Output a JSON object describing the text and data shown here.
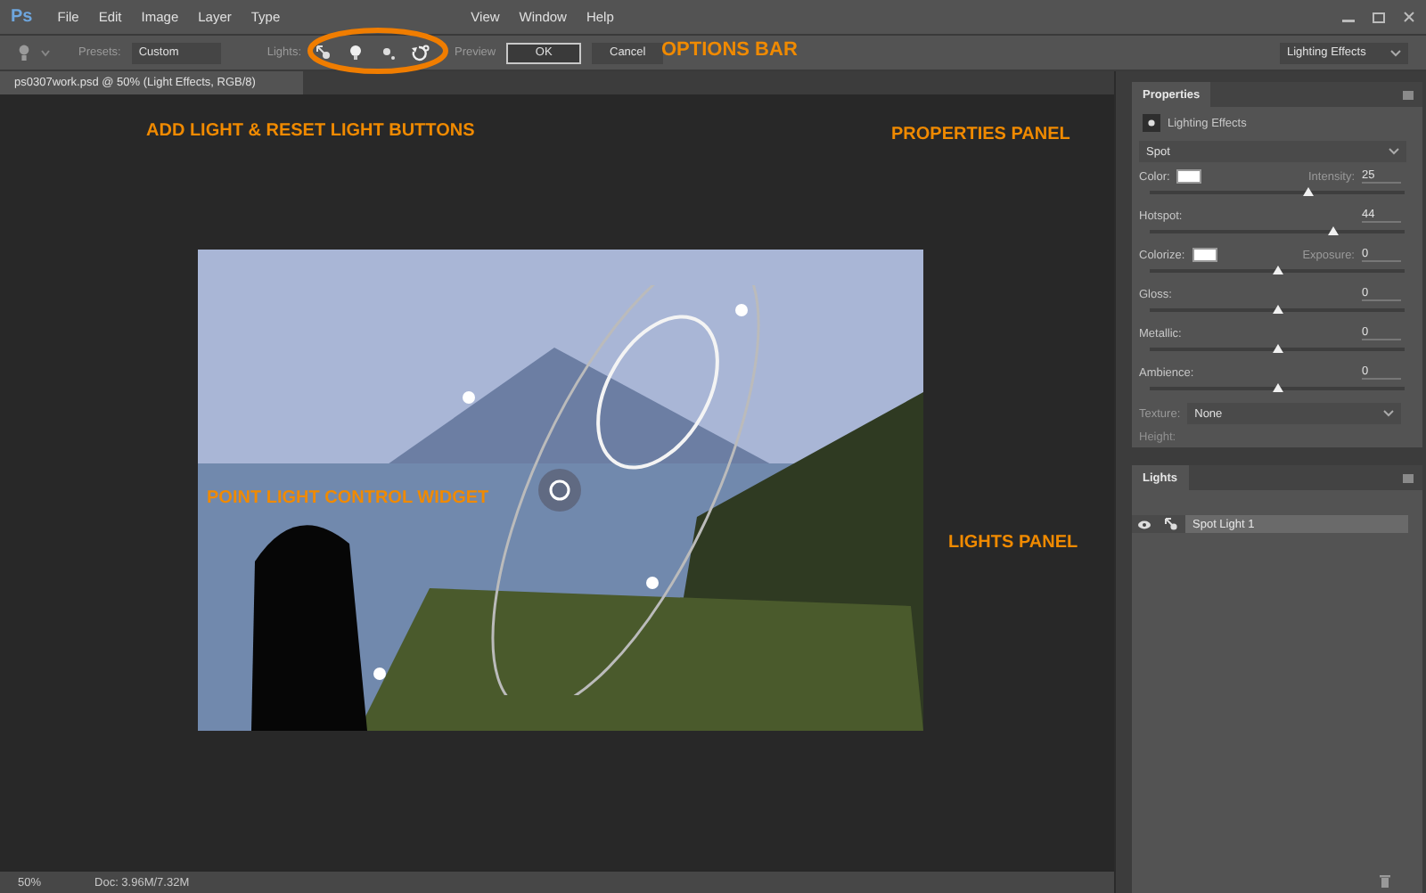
{
  "app": {
    "logo": "Ps"
  },
  "menu": [
    "File",
    "Edit",
    "Image",
    "Layer",
    "Type",
    "View",
    "Window",
    "Help"
  ],
  "options_bar": {
    "presets_label": "Presets:",
    "preset": "Custom",
    "lights_label": "Lights:",
    "preview_label": "Preview",
    "ok": "OK",
    "cancel": "Cancel",
    "workspace": "Lighting Effects"
  },
  "document_tab": {
    "title": "ps0307work.psd @ 50% (Light Effects, RGB/8)"
  },
  "properties": {
    "tab": "Properties",
    "title": "Lighting Effects",
    "light_type": "Spot",
    "rows": [
      {
        "label": "Color:",
        "swatch": true,
        "right_label": "Intensity:",
        "value": "25",
        "level": 0.62
      },
      {
        "label": "Hotspot:",
        "swatch": false,
        "value": "44",
        "level": 0.72
      },
      {
        "label": "Colorize:",
        "swatch": true,
        "right_label": "Exposure:",
        "value": "0",
        "level": 0.5
      },
      {
        "label": "Gloss:",
        "swatch": false,
        "value": "0",
        "level": 0.5
      },
      {
        "label": "Metallic:",
        "swatch": false,
        "value": "0",
        "level": 0.5
      },
      {
        "label": "Ambience:",
        "swatch": false,
        "value": "0",
        "level": 0.5
      }
    ],
    "texture_label": "Texture:",
    "texture": "None",
    "height_label": "Height:"
  },
  "lights": {
    "tab": "Lights",
    "items": [
      {
        "name": "Spot Light 1",
        "visible": true,
        "selected": true
      }
    ]
  },
  "status_bar": {
    "zoom": "50%",
    "doc": "Doc: 3.96M/7.32M"
  },
  "annotations": [
    {
      "text": "OPTIONS BAR"
    },
    {
      "text": "ADD LIGHT & RESET LIGHT BUTTONS"
    },
    {
      "text": "PROPERTIES PANEL"
    },
    {
      "text": "POINT LIGHT CONTROL WIDGET"
    },
    {
      "text": "LIGHTS PANEL"
    }
  ]
}
